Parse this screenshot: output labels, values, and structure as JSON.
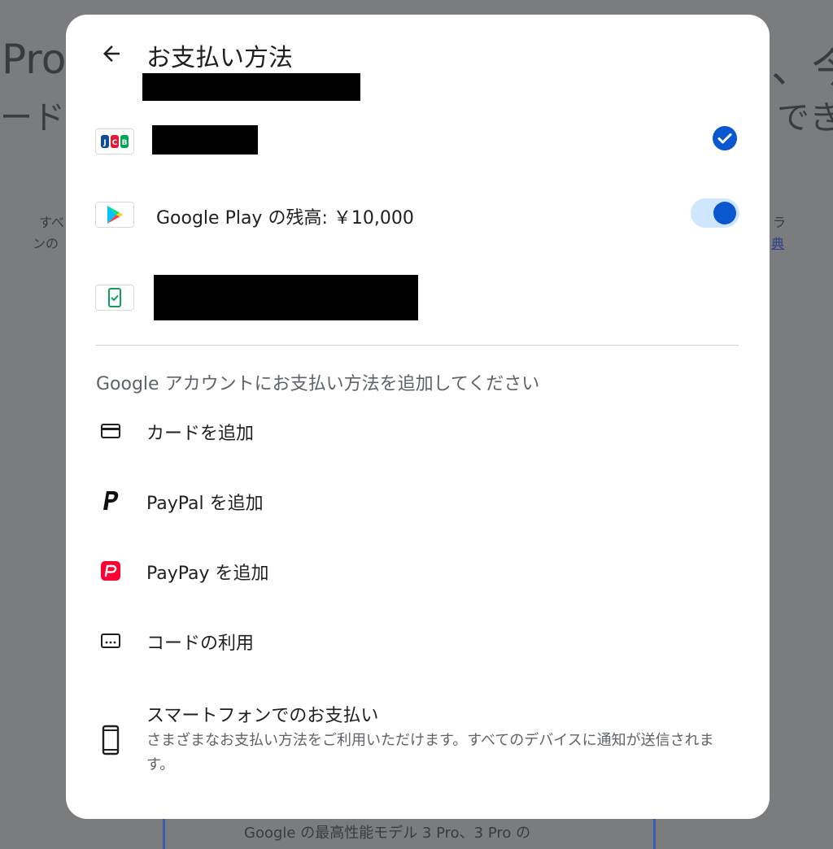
{
  "background": {
    "title_left": "Pro",
    "subtitle_left": "ード",
    "title_right": "、今",
    "subtitle_right": "でき",
    "small_left_1": "すべ",
    "small_left_2": "ンの",
    "small_right_1": "ラ",
    "small_right_2": "典",
    "bottom_text": "Google の最高性能モデル 3 Pro、3 Pro の"
  },
  "dialog": {
    "title": "お支払い方法",
    "payment_methods": [
      {
        "logo": "jcb-logo",
        "label": "",
        "selected": true
      },
      {
        "logo": "google-play-logo",
        "label": "Google Play の残高: ￥10,000",
        "toggle_on": true
      },
      {
        "logo": "carrier-billing-logo",
        "label": ""
      }
    ],
    "add_section": {
      "header": "Google アカウントにお支払い方法を追加してください",
      "items": [
        {
          "icon": "credit-card-icon",
          "label": "カードを追加"
        },
        {
          "icon": "paypal-icon",
          "label": "PayPal を追加"
        },
        {
          "icon": "paypay-icon",
          "label": "PayPay を追加"
        },
        {
          "icon": "redeem-code-icon",
          "label": "コードの利用"
        },
        {
          "icon": "smartphone-icon",
          "label": "スマートフォンでのお支払い",
          "description": "さまざまなお支払い方法をご利用いただけます。すべてのデバイスに通知が送信されます。"
        }
      ]
    }
  },
  "colors": {
    "accent": "#0b57d0",
    "toggle_track": "#cfe6ff",
    "paypay_red": "#ff0033",
    "overlay": "#7b7c7e"
  }
}
